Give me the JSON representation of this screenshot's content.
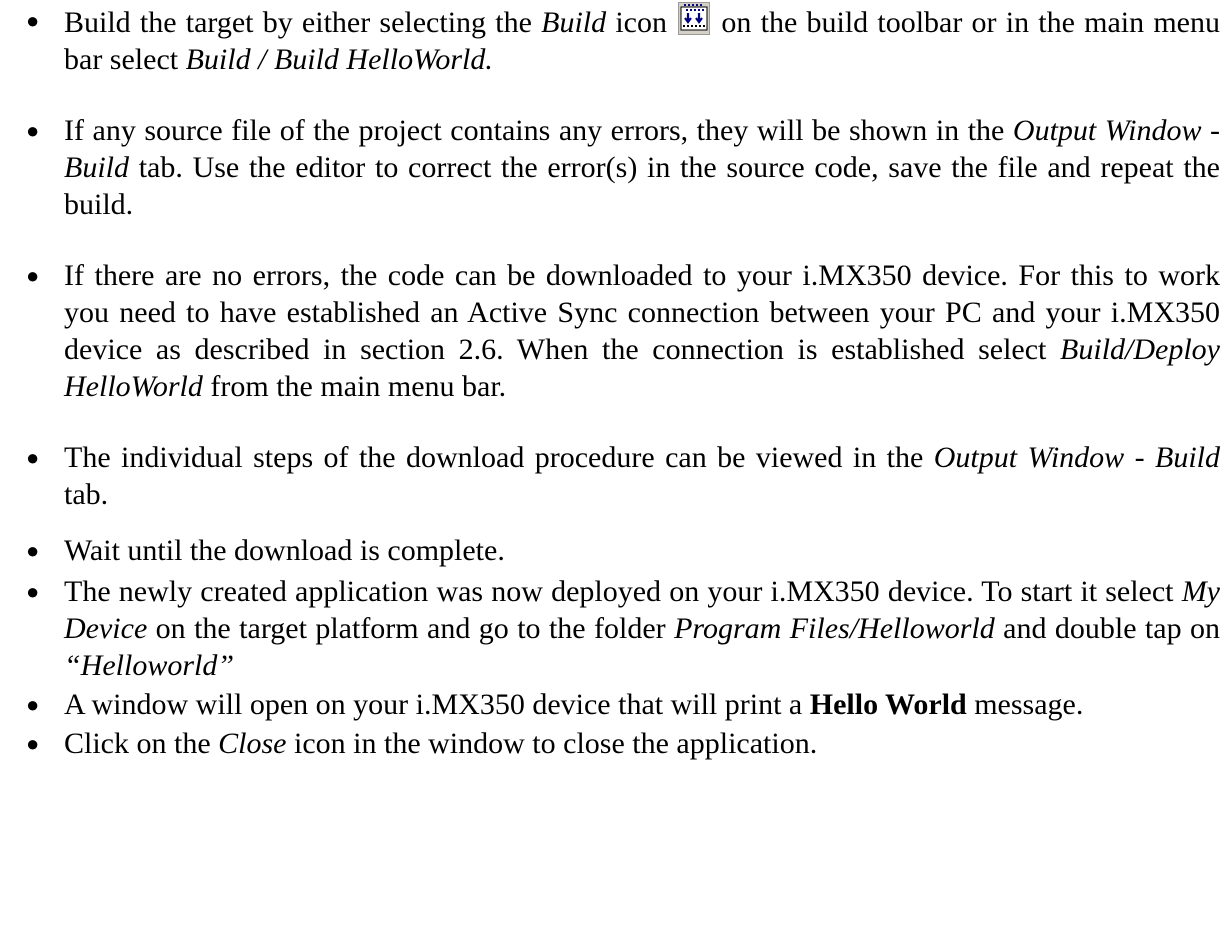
{
  "items": [
    {
      "a1": " Build the target by either selecting the ",
      "a2": "Build",
      "a3": " icon ",
      "a4": " on the build toolbar or in the main menu bar select ",
      "a5": "Build / Build HelloWorld.",
      "icon": "build-icon"
    },
    {
      "a1": " If any source file of the project contains any errors, they will be shown in the ",
      "a2": "Output Window",
      "a3": " - ",
      "a4": "Build",
      "a5": " tab. Use the editor to correct the error(s) in the source code, save the file and repeat the build."
    },
    {
      "a1": " If there are no errors, the code can be downloaded to your i.MX350 device. For this to work you need to have established an Active Sync connection between your PC and your i.MX350 device as described in section 2.6. When the connection is established select ",
      "a2": "Build/Deploy HelloWorld",
      "a3": " from the main menu bar."
    },
    {
      "a1": " The individual steps of the download procedure can be viewed in the ",
      "a2": "Output Window",
      "a3": " - ",
      "a4": "Build",
      "a5": " tab."
    },
    {
      "a1": " Wait until the download is complete."
    },
    {
      "a1": " The newly created application was now deployed on your i.MX350 device. To start it select ",
      "a2": "My Device",
      "a3": " on the target platform and go to the folder ",
      "a4": "Program Files/Helloworld",
      "a5": " and double tap on ",
      "a6": "“Helloworld”"
    },
    {
      "a1": " A window will open on your i.MX350 device that will print a ",
      "a2": "Hello World",
      "a3": " message."
    },
    {
      "a1": " Click on the ",
      "a2": "Close",
      "a3": " icon in the window to close the application."
    }
  ]
}
